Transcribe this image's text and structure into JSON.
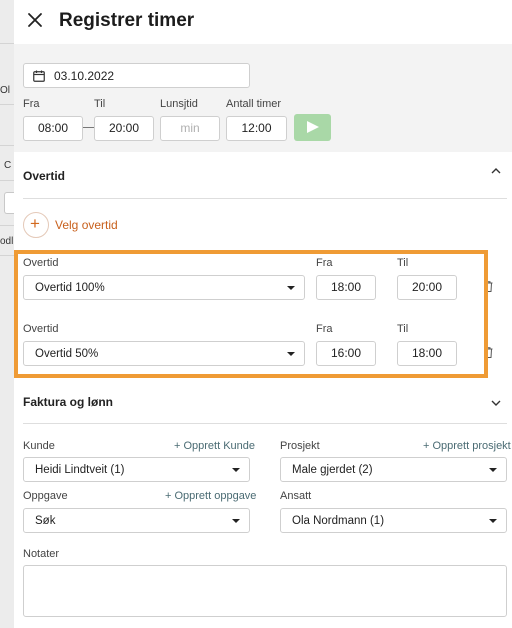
{
  "backdrop": {
    "fragments": [
      "Ol",
      "C",
      "odl"
    ]
  },
  "header": {
    "title": "Registrer timer",
    "close_icon": "close-icon"
  },
  "date": {
    "value": "03.10.2022",
    "icon": "calendar-icon"
  },
  "time": {
    "from_label": "Fra",
    "from_value": "08:00",
    "to_label": "Til",
    "to_value": "20:00",
    "lunch_label": "Lunsjtid",
    "lunch_placeholder": "min",
    "hours_label": "Antall timer",
    "hours_value": "12:00",
    "submit_icon": "play-icon",
    "submit_color": "#a9d8a7"
  },
  "overtime": {
    "title": "Overtid",
    "add_label": "Velg overtid",
    "accent_color": "#c8601c",
    "highlight_color": "#ef9b35",
    "rows": [
      {
        "type_label": "Overtid",
        "type_value": "Overtid 100%",
        "from_label": "Fra",
        "from_value": "18:00",
        "to_label": "Til",
        "to_value": "20:00"
      },
      {
        "type_label": "Overtid",
        "type_value": "Overtid 50%",
        "from_label": "Fra",
        "from_value": "16:00",
        "to_label": "Til",
        "to_value": "18:00"
      }
    ]
  },
  "billing": {
    "title": "Faktura og lønn",
    "customer_label": "Kunde",
    "customer_value": "Heidi Lindtveit (1)",
    "customer_create": "+ Opprett Kunde",
    "project_label": "Prosjekt",
    "project_value": "Male gjerdet (2)",
    "project_create": "+ Opprett prosjekt",
    "task_label": "Oppgave",
    "task_value": "Søk",
    "task_create": "+ Opprett oppgave",
    "employee_label": "Ansatt",
    "employee_value": "Ola Nordmann (1)",
    "notes_label": "Notater",
    "link_color": "#4a6b73"
  }
}
